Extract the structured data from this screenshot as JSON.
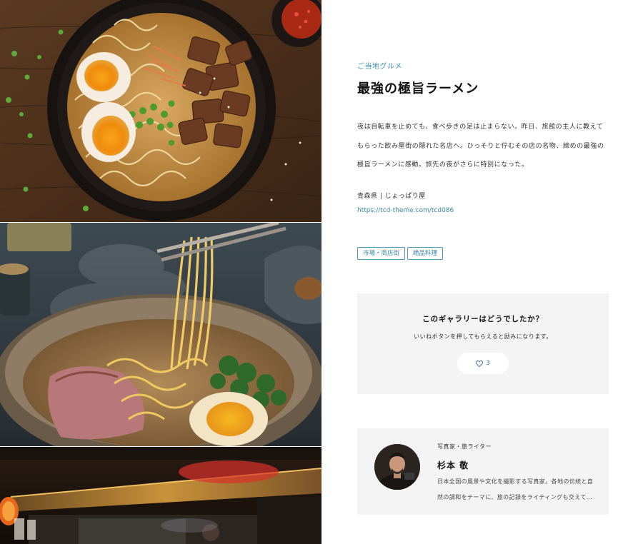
{
  "gallery": {
    "images": [
      {
        "name": "tonkotsu ramen bowl"
      },
      {
        "name": "miso ramen with noodle lift"
      },
      {
        "name": "yokocho alley night"
      }
    ]
  },
  "article": {
    "category": "ご当地グルメ",
    "title": "最強の極旨ラーメン",
    "description": "夜は自転車を止めても、食べ歩きの足は止まらない。昨日、旅館の主人に教えてもらった飲み屋街の隠れた名店へ。ひっそりと佇むその店の名物、締めの最強の極旨ラーメンに感動。旅先の夜がさらに特別になった。",
    "location": "青森県 | じょっぱり屋",
    "link": "https://tcd-theme.com/tcd086",
    "tags": [
      "市場・商店街",
      "絶品料理"
    ]
  },
  "rating": {
    "question": "このギャラリーはどうでしたか？",
    "subtext": "いいねボタンを押してもらえると励みになります。",
    "like_count": "3",
    "like_icon": "heart-icon"
  },
  "author": {
    "role": "写真家・旅ライター",
    "name": "杉本 敬",
    "bio": "日本全国の風景や文化を撮影する写真家。各地の伝統と自然の調和をテーマに、旅の記録をライティングも交えて…"
  },
  "colors": {
    "accent": "#3a95b3",
    "panel": "#f4f4f4",
    "like": "#3a6fb0"
  }
}
